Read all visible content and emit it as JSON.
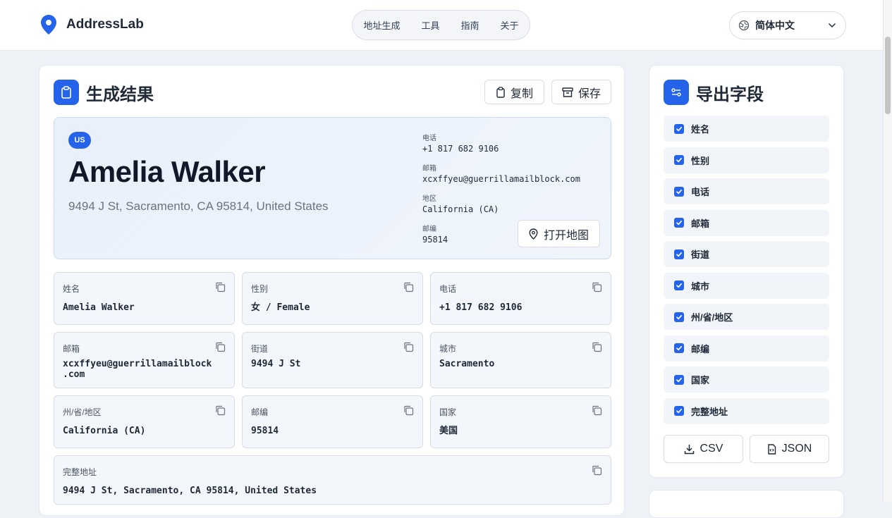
{
  "header": {
    "app_name": "AddressLab",
    "nav": [
      "地址生成",
      "工具",
      "指南",
      "关于"
    ],
    "language": "简体中文"
  },
  "result": {
    "title": "生成结果",
    "copy_label": "复制",
    "save_label": "保存",
    "country_code": "US",
    "name": "Amelia Walker",
    "full_address": "9494 J St, Sacramento, CA 95814, United States",
    "info": [
      {
        "label": "电话",
        "value": "+1 817 682 9106"
      },
      {
        "label": "邮箱",
        "value": "xcxffyeu@guerrillamailblock.com"
      },
      {
        "label": "地区",
        "value": "California (CA)"
      },
      {
        "label": "邮编",
        "value": "95814"
      }
    ],
    "open_map_label": "打开地图"
  },
  "fields": [
    {
      "label": "姓名",
      "value": "Amelia Walker"
    },
    {
      "label": "性别",
      "value": "女 / Female"
    },
    {
      "label": "电话",
      "value": "+1 817 682 9106"
    },
    {
      "label": "邮箱",
      "value": "xcxffyeu@guerrillamailblock",
      "value2": ".com"
    },
    {
      "label": "街道",
      "value": "9494 J St"
    },
    {
      "label": "城市",
      "value": "Sacramento"
    },
    {
      "label": "州/省/地区",
      "value": "California (CA)"
    },
    {
      "label": "邮编",
      "value": "95814"
    },
    {
      "label": "国家",
      "value": "美国"
    },
    {
      "label": "完整地址",
      "value": "9494 J St, Sacramento, CA 95814, United States"
    }
  ],
  "export": {
    "title": "导出字段",
    "fields": [
      "姓名",
      "性别",
      "电话",
      "邮箱",
      "街道",
      "城市",
      "州/省/地区",
      "邮编",
      "国家",
      "完整地址"
    ],
    "checked": [
      true,
      true,
      true,
      true,
      true,
      true,
      true,
      true,
      true,
      true
    ],
    "csv_label": "CSV",
    "json_label": "JSON"
  },
  "colors": {
    "accent": "#2563eb",
    "background": "#eef2f7"
  }
}
